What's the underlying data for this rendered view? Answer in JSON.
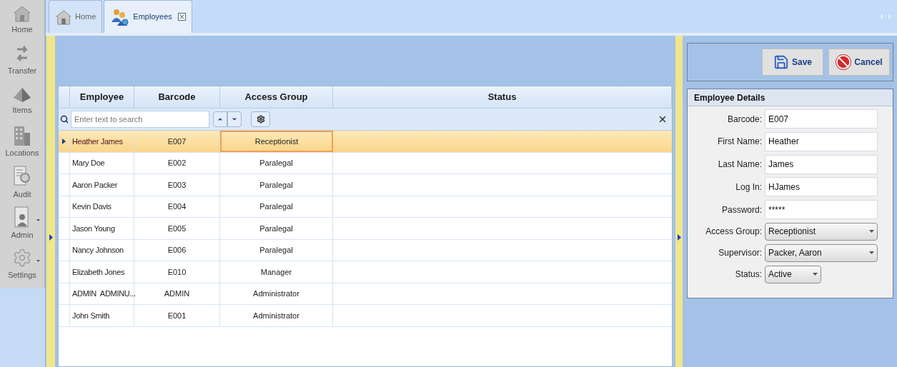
{
  "nav": [
    {
      "label": "Home",
      "kind": "house",
      "has_menu": false
    },
    {
      "label": "Transfer",
      "kind": "arrows",
      "has_menu": false
    },
    {
      "label": "Items",
      "kind": "pyramid",
      "has_menu": false
    },
    {
      "label": "Locations",
      "kind": "building",
      "has_menu": false
    },
    {
      "label": "Audit",
      "kind": "document",
      "has_menu": false
    },
    {
      "label": "Admin",
      "kind": "person",
      "has_menu": true
    },
    {
      "label": "Settings",
      "kind": "gear",
      "has_menu": true
    }
  ],
  "tabs": [
    {
      "label": "Home",
      "kind": "house",
      "selected": false,
      "closable": false
    },
    {
      "label": "Employees",
      "kind": "people",
      "selected": true,
      "closable": true
    }
  ],
  "grid": {
    "columns": [
      "Employee",
      "Barcode",
      "Access Group",
      "Status"
    ],
    "search": {
      "placeholder": "Enter text to search"
    },
    "rows": [
      {
        "employee": "Heather James",
        "barcode": "E007",
        "access_group": "Receptionist",
        "selected": true
      },
      {
        "employee": "Mary Doe",
        "barcode": "E002",
        "access_group": "Paralegal",
        "selected": false
      },
      {
        "employee": "Aaron Packer",
        "barcode": "E003",
        "access_group": "Paralegal",
        "selected": false
      },
      {
        "employee": "Kevin Davis",
        "barcode": "E004",
        "access_group": "Paralegal",
        "selected": false
      },
      {
        "employee": "Jason Young",
        "barcode": "E005",
        "access_group": "Paralegal",
        "selected": false
      },
      {
        "employee": "Nancy Johnson",
        "barcode": "E006",
        "access_group": "Paralegal",
        "selected": false
      },
      {
        "employee": "Elizabeth Jones",
        "barcode": "E010",
        "access_group": "Manager",
        "selected": false
      },
      {
        "employee": "ADMIN  ADMINU...",
        "barcode": "ADMIN",
        "access_group": "Administrator",
        "selected": false
      },
      {
        "employee": "John Smith",
        "barcode": "E001",
        "access_group": "Administrator",
        "selected": false
      }
    ]
  },
  "actions": [
    {
      "label": "Save",
      "kind": "save"
    },
    {
      "label": "Cancel",
      "kind": "cancel"
    }
  ],
  "details": {
    "title": "Employee Details",
    "fields": [
      {
        "label": "Barcode:",
        "value": "E007",
        "kind": "text"
      },
      {
        "label": "First Name:",
        "value": "Heather",
        "kind": "text"
      },
      {
        "label": "Last Name:",
        "value": "James",
        "kind": "text"
      },
      {
        "label": "Log In:",
        "value": "HJames",
        "kind": "text"
      },
      {
        "label": "Password:",
        "value": "*****",
        "kind": "text"
      },
      {
        "label": "Access Group:",
        "value": "Receptionist",
        "kind": "select"
      },
      {
        "label": "Supervisor:",
        "value": "Packer, Aaron",
        "kind": "select"
      },
      {
        "label": "Status:",
        "value": "Active",
        "kind": "short-select"
      }
    ]
  }
}
